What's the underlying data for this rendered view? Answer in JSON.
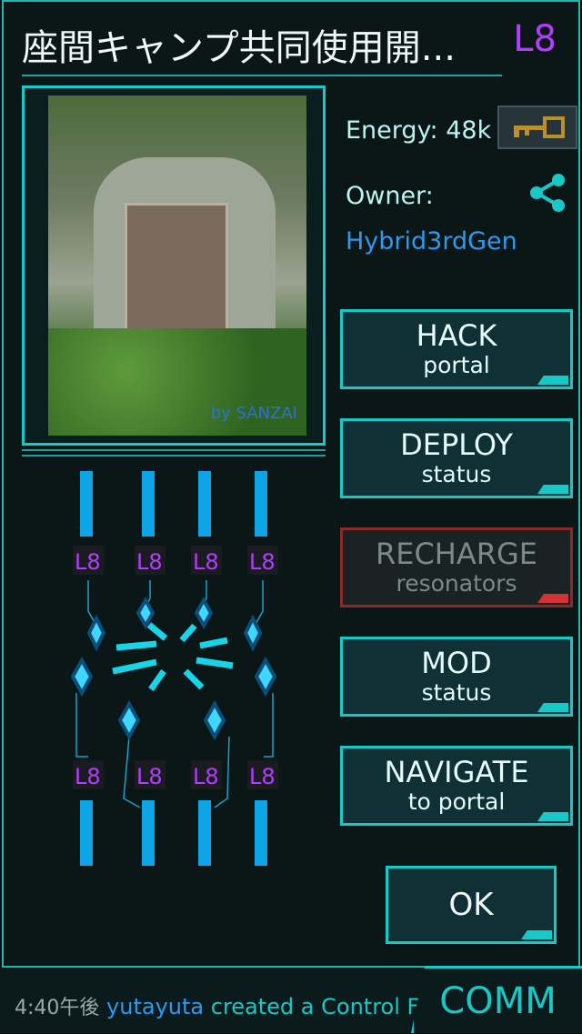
{
  "portal": {
    "title": "座間キャンプ共同使用開...",
    "level": "L8",
    "energy_label": "Energy: 48k",
    "owner_label": "Owner:",
    "owner_name": "Hybrid3rdGen",
    "photo_credit": "by SANZAI"
  },
  "icons": {
    "key": "key-icon",
    "share": "share-icon"
  },
  "actions": [
    {
      "line1": "HACK",
      "line2": "portal",
      "enabled": true
    },
    {
      "line1": "DEPLOY",
      "line2": "status",
      "enabled": true
    },
    {
      "line1": "RECHARGE",
      "line2": "resonators",
      "enabled": false
    },
    {
      "line1": "MOD",
      "line2": "status",
      "enabled": true
    },
    {
      "line1": "NAVIGATE",
      "line2": "to portal",
      "enabled": true
    }
  ],
  "ok_label": "OK",
  "resonators": {
    "top_levels": [
      "L8",
      "L8",
      "L8",
      "L8"
    ],
    "bottom_levels": [
      "L8",
      "L8",
      "L8",
      "L8"
    ]
  },
  "comm": {
    "time": "4:40午後",
    "agent": "yutayuta",
    "message": "created a Control Field",
    "button_label": "COMM"
  },
  "colors": {
    "accent": "#18c8c6",
    "level": "#b43cff",
    "owner": "#2b9af0",
    "disabled_accent": "#d23232"
  }
}
